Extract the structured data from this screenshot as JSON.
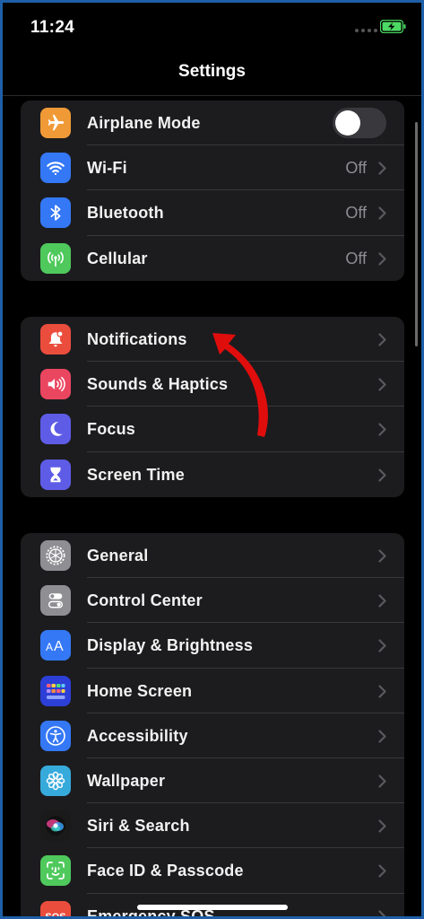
{
  "status_bar": {
    "time": "11:24"
  },
  "nav": {
    "title": "Settings"
  },
  "groups": [
    {
      "items": [
        {
          "label": "Airplane Mode",
          "icon": "airplane-icon",
          "color": "#f09a37",
          "toggle": false
        },
        {
          "label": "Wi-Fi",
          "icon": "wifi-icon",
          "color": "#3478f6",
          "value": "Off"
        },
        {
          "label": "Bluetooth",
          "icon": "bluetooth-icon",
          "color": "#3478f6",
          "value": "Off"
        },
        {
          "label": "Cellular",
          "icon": "cellular-icon",
          "color": "#4fc95c",
          "value": "Off"
        }
      ]
    },
    {
      "items": [
        {
          "label": "Notifications",
          "icon": "notifications-icon",
          "color": "#eb4d3d"
        },
        {
          "label": "Sounds & Haptics",
          "icon": "speaker-icon",
          "color": "#eb4660"
        },
        {
          "label": "Focus",
          "icon": "moon-icon",
          "color": "#5e5ce6"
        },
        {
          "label": "Screen Time",
          "icon": "hourglass-icon",
          "color": "#5e5ce6"
        }
      ]
    },
    {
      "items": [
        {
          "label": "General",
          "icon": "gear-icon",
          "color": "#8e8e93"
        },
        {
          "label": "Control Center",
          "icon": "switches-icon",
          "color": "#8e8e93"
        },
        {
          "label": "Display & Brightness",
          "icon": "text-size-icon",
          "color": "#3478f6"
        },
        {
          "label": "Home Screen",
          "icon": "home-grid-icon",
          "color": "#2c3fd6"
        },
        {
          "label": "Accessibility",
          "icon": "accessibility-icon",
          "color": "#3478f6"
        },
        {
          "label": "Wallpaper",
          "icon": "flower-icon",
          "color": "#37aadc"
        },
        {
          "label": "Siri & Search",
          "icon": "siri-icon",
          "color": "#1a1a1a"
        },
        {
          "label": "Face ID & Passcode",
          "icon": "face-id-icon",
          "color": "#4fc95c"
        },
        {
          "label": "Emergency SOS",
          "icon": "sos-icon",
          "color": "#eb4d3d"
        }
      ]
    }
  ]
}
